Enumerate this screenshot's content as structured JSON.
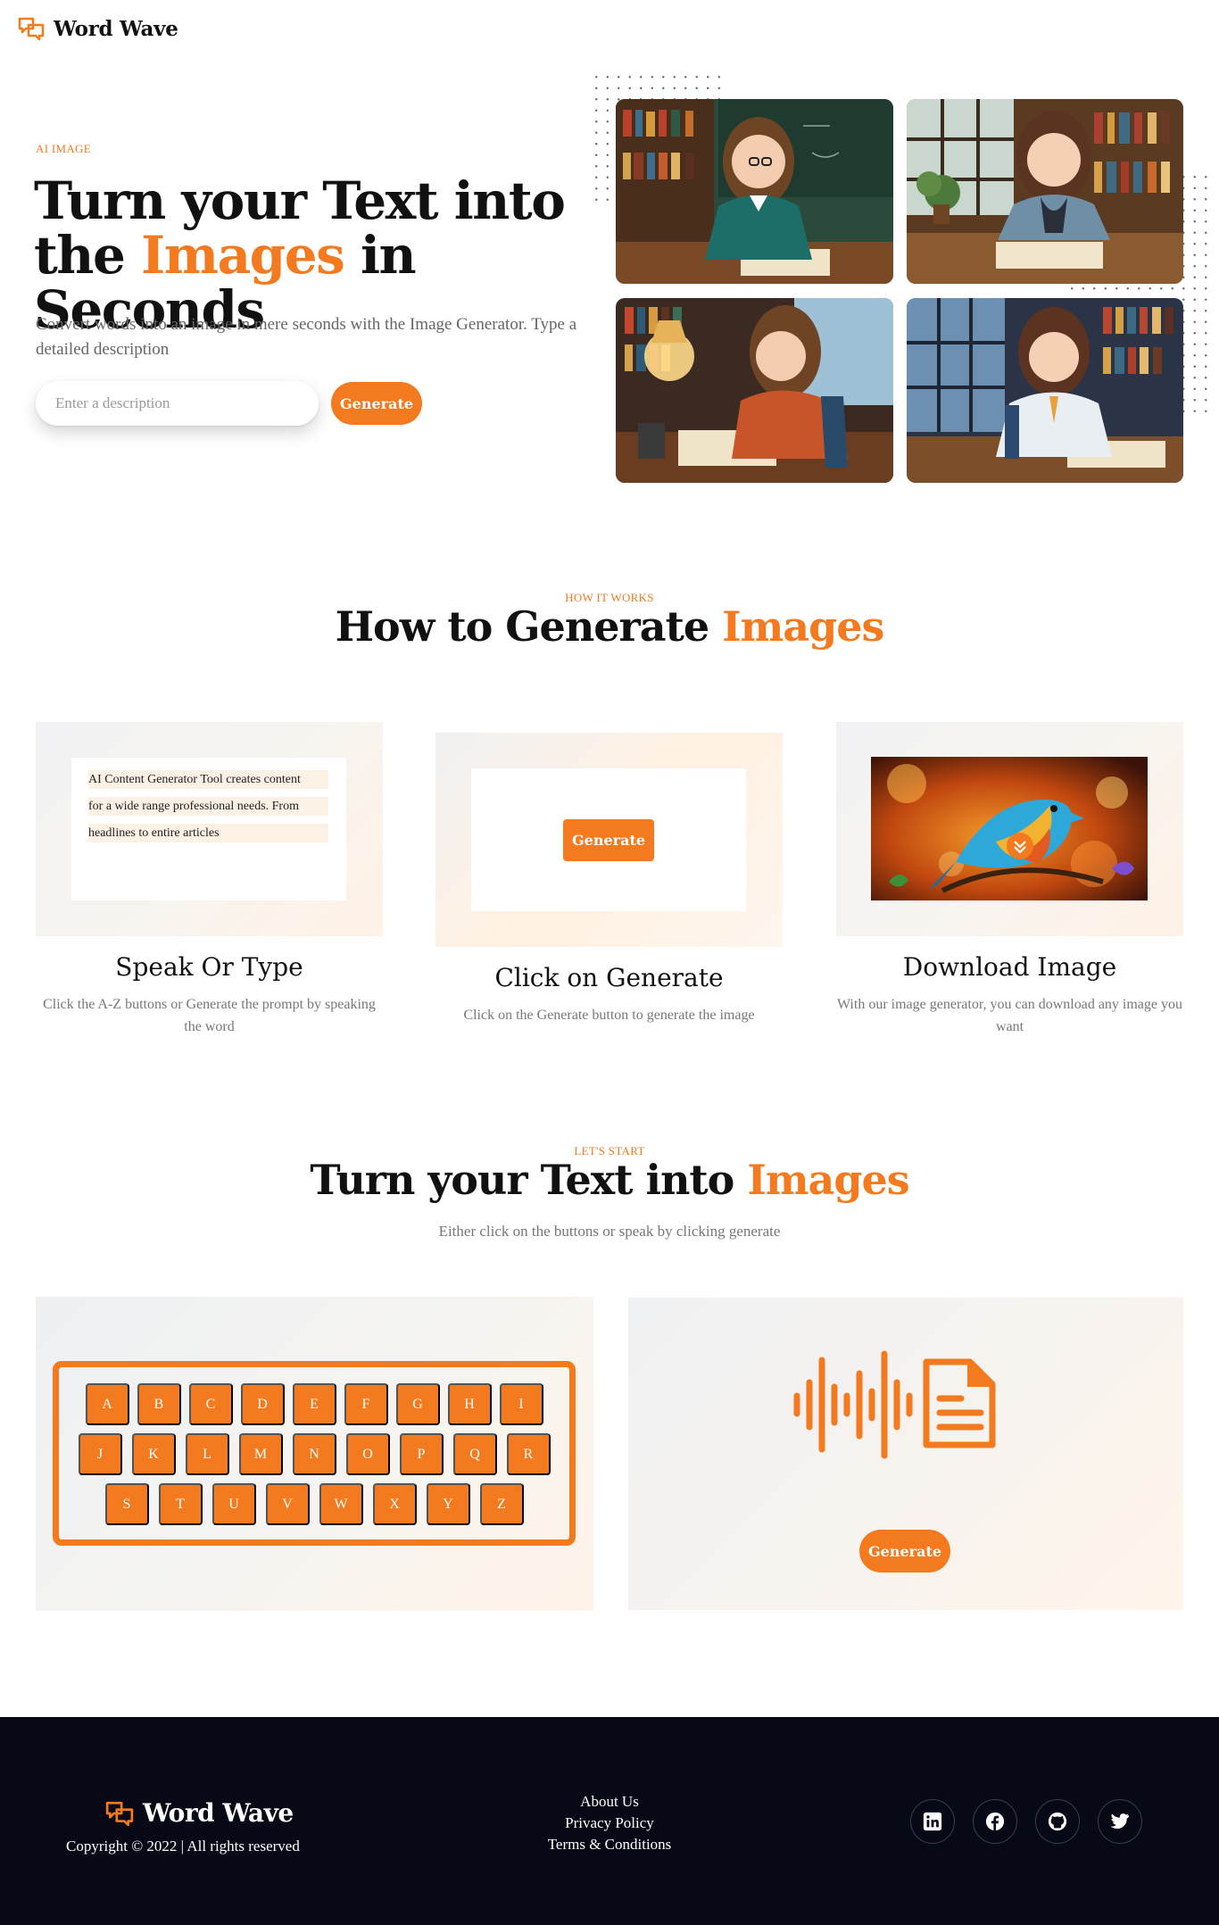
{
  "nav": {
    "brand": "Word Wave"
  },
  "hero": {
    "eyebrow": "AI IMAGE",
    "title_part1": "Turn your Text into",
    "title_part2_prefix": "the ",
    "title_highlight": "Images",
    "title_part2_suffix": " in Seconds",
    "subtitle": "Convert words into an image in mere seconds with the Image Generator. Type a detailed description",
    "input_placeholder": "Enter a description",
    "generate_label": "Generate"
  },
  "how": {
    "eyebrow": "HOW IT WORKS",
    "title_prefix": "How to Generate ",
    "title_highlight": "Images",
    "steps": [
      {
        "title": "Speak Or Type",
        "desc": "Click the A-Z buttons or Generate the prompt by speaking the word",
        "lines": [
          "AI Content Generator Tool creates content",
          "for a wide range professional needs. From",
          "headlines to entire articles"
        ]
      },
      {
        "title": "Click on Generate",
        "desc": "Click on the Generate button to generate the image",
        "button": "Generate"
      },
      {
        "title": "Download Image",
        "desc": "With our image generator, you can download any image you want"
      }
    ]
  },
  "start": {
    "eyebrow": "LET'S START",
    "title_prefix": "Turn your Text into ",
    "title_highlight": "Images",
    "subtitle": "Either click on the buttons or speak by clicking generate",
    "keys_row1": [
      "A",
      "B",
      "C",
      "D",
      "E",
      "F",
      "G",
      "H",
      "I"
    ],
    "keys_row2": [
      "J",
      "K",
      "L",
      "M",
      "N",
      "O",
      "P",
      "Q",
      "R"
    ],
    "keys_row3": [
      "S",
      "T",
      "U",
      "V",
      "W",
      "X",
      "Y",
      "Z"
    ],
    "voice_generate": "Generate"
  },
  "footer": {
    "brand": "Word Wave",
    "copyright": "Copyright © 2022 | All rights reserved",
    "links": [
      "About Us",
      "Privacy Policy",
      "Terms & Conditions"
    ],
    "socials": [
      "linkedin-icon",
      "facebook-icon",
      "github-icon",
      "twitter-icon"
    ]
  },
  "colors": {
    "accent": "#f47a1f",
    "footer_bg": "#070a16",
    "text_dark": "#111111",
    "text_muted": "#777777"
  }
}
